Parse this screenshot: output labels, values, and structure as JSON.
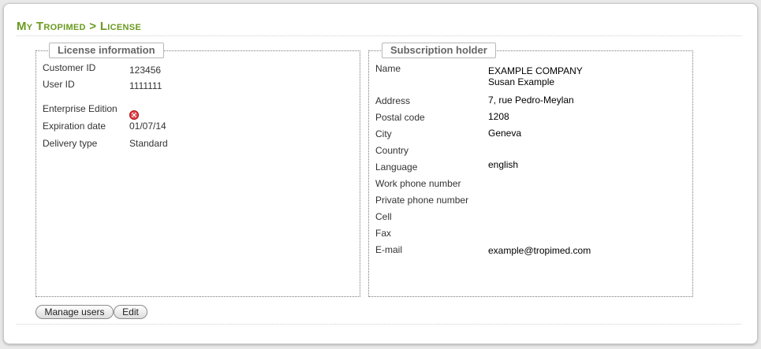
{
  "breadcrumb": {
    "root": "My Tropimed",
    "separator": ">",
    "current": "License"
  },
  "license": {
    "title": "License information",
    "customer_id_label": "Customer ID",
    "customer_id": "123456",
    "user_id_label": "User ID",
    "user_id": "1111111",
    "enterprise_label": "Enterprise Edition",
    "enterprise_status_icon": "error-x-icon",
    "expiration_label": "Expiration date",
    "expiration": "01/07/14",
    "delivery_label": "Delivery type",
    "delivery": "Standard"
  },
  "holder": {
    "title": "Subscription holder",
    "name_label": "Name",
    "company": "EXAMPLE COMPANY",
    "person": "Susan Example",
    "address_label": "Address",
    "address": "7, rue Pedro-Meylan",
    "postal_label": "Postal code",
    "postal": "1208",
    "city_label": "City",
    "city": "Geneva",
    "country_label": "Country",
    "language_label": "Language",
    "language": "english",
    "work_phone_label": "Work phone number",
    "private_phone_label": "Private phone number",
    "cell_label": "Cell",
    "fax_label": "Fax",
    "email_label": "E-mail",
    "email": "example@tropimed.com"
  },
  "actions": {
    "manage_users": "Manage users",
    "edit": "Edit"
  },
  "colors": {
    "brand": "#6a9a1f",
    "error": "#d9242a"
  }
}
